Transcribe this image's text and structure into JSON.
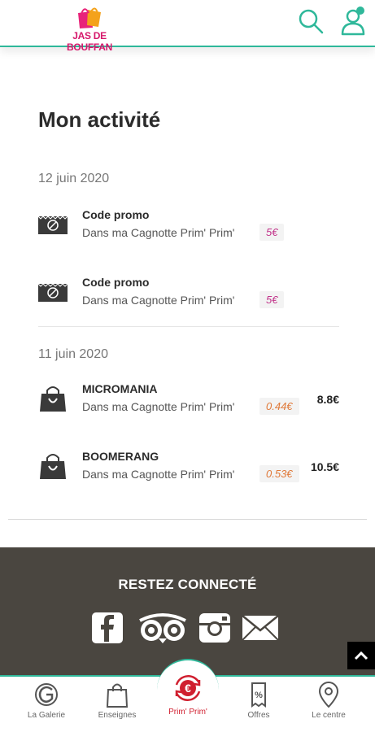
{
  "header": {
    "logo_text": "JAS DE BOUFFAN",
    "search_icon": "search-icon",
    "user_icon": "user-icon",
    "accent": "#2fb89a"
  },
  "main": {
    "title": "Mon activité",
    "groups": [
      {
        "date": "12 juin 2020",
        "items": [
          {
            "icon": "coupon-icon",
            "title": "Code promo",
            "subtitle": "Dans ma Cagnotte Prim' Prim'",
            "pill": "5€",
            "amount": ""
          },
          {
            "icon": "coupon-icon",
            "title": "Code promo",
            "subtitle": "Dans ma Cagnotte Prim' Prim'",
            "pill": "5€",
            "amount": ""
          }
        ]
      },
      {
        "date": "11 juin 2020",
        "items": [
          {
            "icon": "shopping-bag-icon",
            "title": "MICROMANIA",
            "subtitle": "Dans ma Cagnotte Prim' Prim'",
            "pill": "0.44€",
            "amount": "8.8€"
          },
          {
            "icon": "shopping-bag-icon",
            "title": "BOOMERANG",
            "subtitle": "Dans ma Cagnotte Prim' Prim'",
            "pill": "0.53€",
            "amount": "10.5€"
          }
        ]
      }
    ]
  },
  "footer": {
    "connect_title": "RESTEZ CONNECTÉ",
    "social": [
      "facebook-icon",
      "tripadvisor-icon",
      "instagram-icon",
      "mail-icon"
    ],
    "background": "#4a4640"
  },
  "bottom_nav": {
    "items": [
      {
        "label": "La Galerie",
        "icon": "galerie-logo-icon"
      },
      {
        "label": "Enseignes",
        "icon": "shopping-bag-icon"
      },
      {
        "label": "Prim' Prim'",
        "icon": "euro-coin-icon",
        "active": true
      },
      {
        "label": "Offres",
        "icon": "percent-tag-icon"
      },
      {
        "label": "Le centre",
        "icon": "map-pin-icon"
      }
    ],
    "active_color": "#d01f2f"
  }
}
